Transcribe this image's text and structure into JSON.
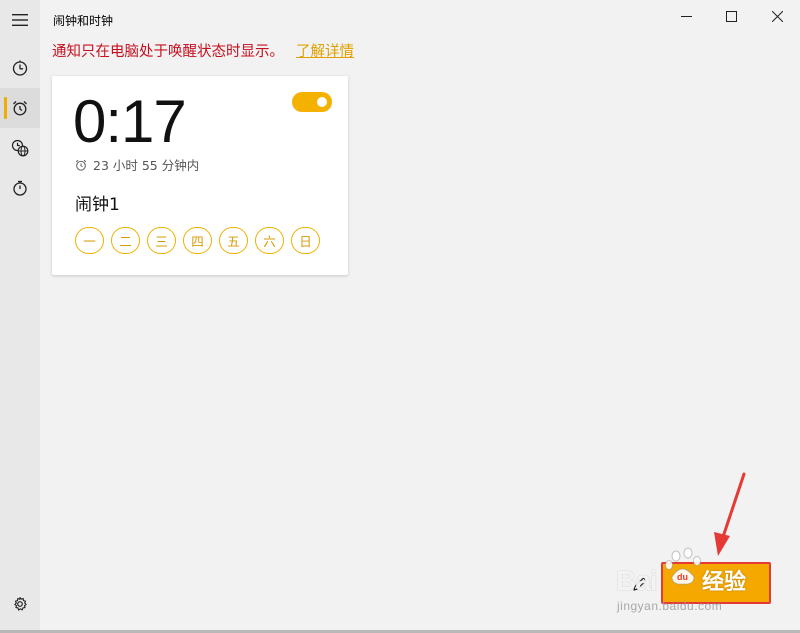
{
  "window": {
    "title": "闹钟和时钟",
    "minimize_glyph": "—",
    "maximize_glyph": "☐",
    "close_glyph": "✕"
  },
  "nav": {
    "items": [
      {
        "name": "hamburger-menu",
        "icon": "menu-icon"
      },
      {
        "name": "timer",
        "icon": "timer-icon"
      },
      {
        "name": "alarm",
        "icon": "alarm-clock-icon",
        "active": true
      },
      {
        "name": "world-clock",
        "icon": "world-clock-icon"
      },
      {
        "name": "stopwatch",
        "icon": "stopwatch-icon"
      },
      {
        "name": "settings",
        "icon": "gear-icon"
      }
    ]
  },
  "notice": {
    "text": "通知只在电脑处于唤醒状态时显示。",
    "link": "了解详情"
  },
  "alarm": {
    "time": "0:17",
    "enabled": true,
    "remaining": "23 小时 55 分钟内",
    "name": "闹钟1",
    "days": [
      "一",
      "二",
      "三",
      "四",
      "五",
      "六",
      "日"
    ]
  },
  "watermark": {
    "brand": "Bai",
    "product": "经验",
    "url": "jingyan.baidu.com"
  },
  "colors": {
    "accent": "#f5b100",
    "notice_red": "#c50f1f",
    "annotation_red": "#e53935"
  }
}
